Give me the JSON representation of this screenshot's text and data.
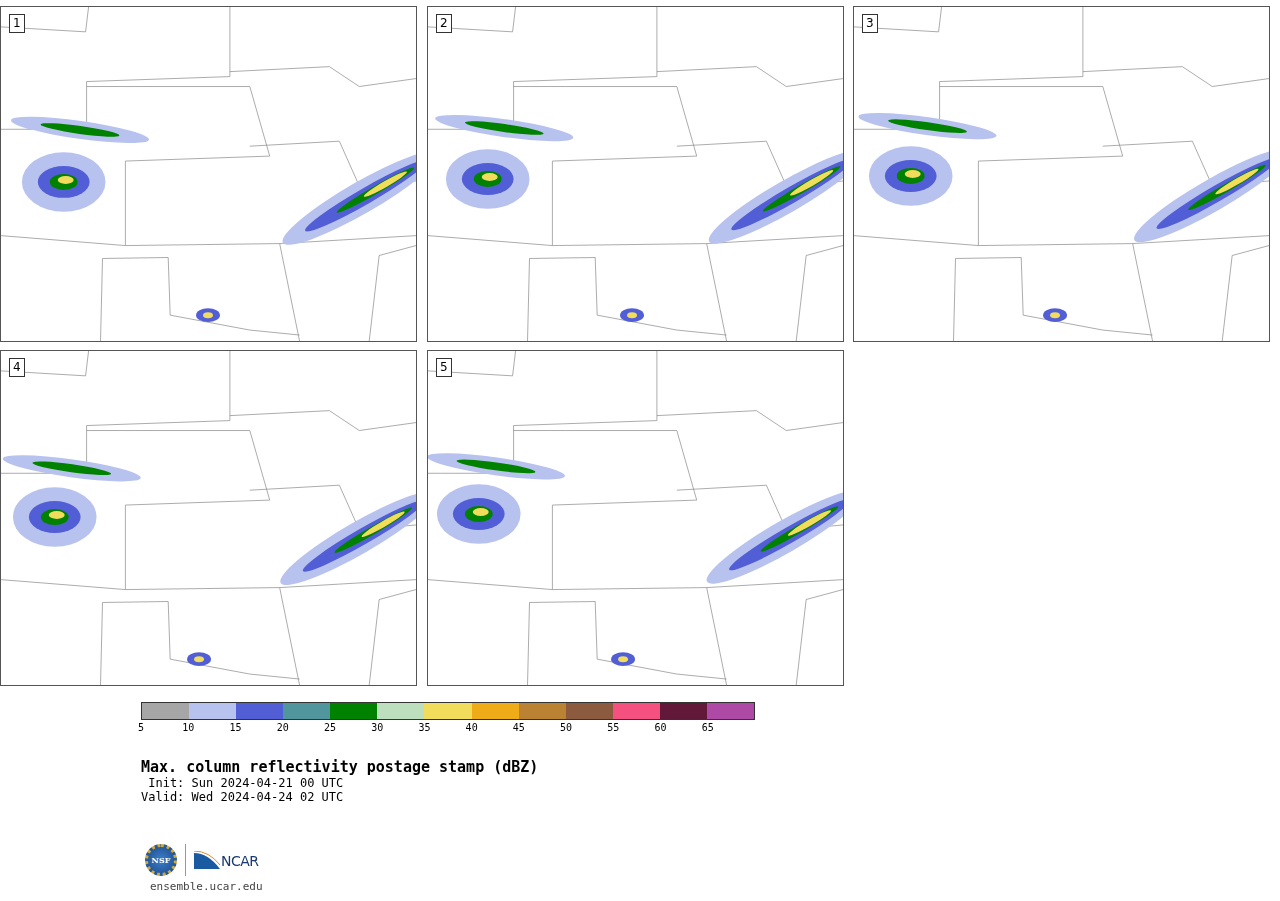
{
  "panels": [
    {
      "label": "1"
    },
    {
      "label": "2"
    },
    {
      "label": "3"
    },
    {
      "label": "4"
    },
    {
      "label": "5"
    }
  ],
  "colorbar": {
    "bins": [
      {
        "color": "#a6a6a6",
        "label": "5"
      },
      {
        "color": "#b8c2ee",
        "label": "10"
      },
      {
        "color": "#525ed6",
        "label": "15"
      },
      {
        "color": "#50969c",
        "label": "20"
      },
      {
        "color": "#008200",
        "label": "25"
      },
      {
        "color": "#bedfbe",
        "label": "30"
      },
      {
        "color": "#f2dc5c",
        "label": "35"
      },
      {
        "color": "#f0ac18",
        "label": "40"
      },
      {
        "color": "#ba8232",
        "label": "45"
      },
      {
        "color": "#8c5a3e",
        "label": "50"
      },
      {
        "color": "#f45080",
        "label": "55"
      },
      {
        "color": "#621838",
        "label": "60"
      },
      {
        "color": "#ae4aa6",
        "label": "65"
      }
    ]
  },
  "title": "Max. column reflectivity postage stamp (dBZ)",
  "init": " Init: Sun 2024-04-21 00 UTC",
  "valid": "Valid: Wed 2024-04-24 02 UTC",
  "logos": {
    "left": "NSF",
    "right": "NCAR"
  },
  "url": "ensemble.ucar.edu"
}
